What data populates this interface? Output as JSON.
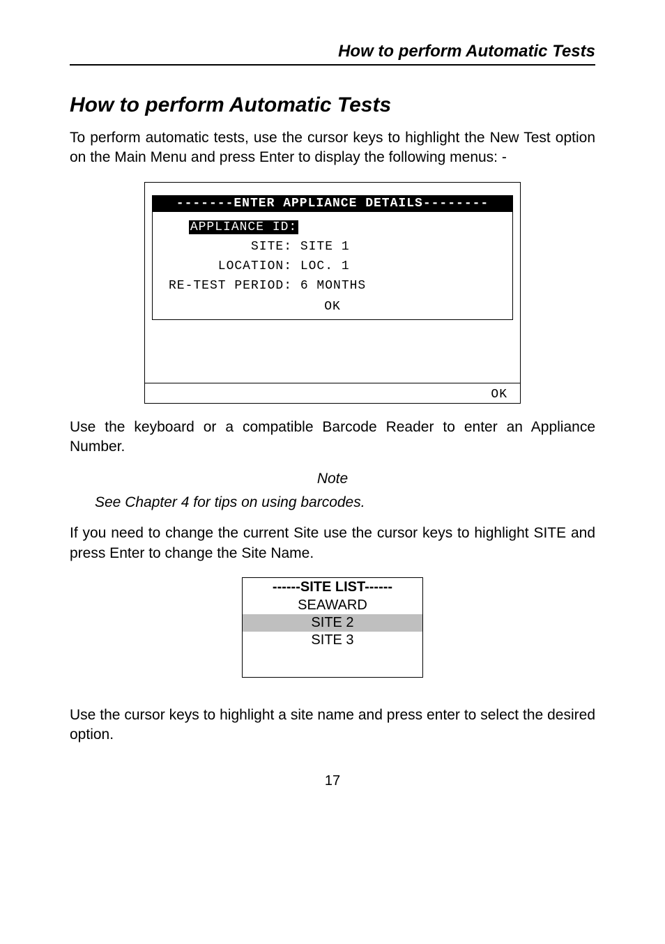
{
  "header": {
    "title": "How to perform Automatic Tests"
  },
  "section_title": "How to perform Automatic Tests",
  "para1": "To perform automatic tests, use the cursor keys to highlight the New Test option on the Main Menu and press Enter to display the following menus: -",
  "lcd": {
    "title": "-------ENTER APPLIANCE DETAILS--------",
    "appliance_id_label": "APPLIANCE ID:",
    "appliance_id_value": "",
    "site_label": "SITE:",
    "site_value": "SITE 1",
    "location_label": "LOCATION:",
    "location_value": "LOC. 1",
    "retest_label": "RE-TEST PERIOD:",
    "retest_value": "6 MONTHS",
    "ok_inner": "OK",
    "ok_outer": "OK"
  },
  "para2": "Use the keyboard or a compatible Barcode Reader to enter an Appliance Number.",
  "note_label": "Note",
  "note_text": "See Chapter 4 for tips on using barcodes.",
  "para3": "If you need to change the current Site use the cursor keys to highlight SITE and press Enter to change the Site Name.",
  "site_list": {
    "title": "------SITE LIST------",
    "items": [
      "SEAWARD",
      "SITE 2",
      "SITE 3"
    ]
  },
  "para4": "Use the cursor keys to highlight a site name and press enter to select the desired option.",
  "page_number": "17"
}
